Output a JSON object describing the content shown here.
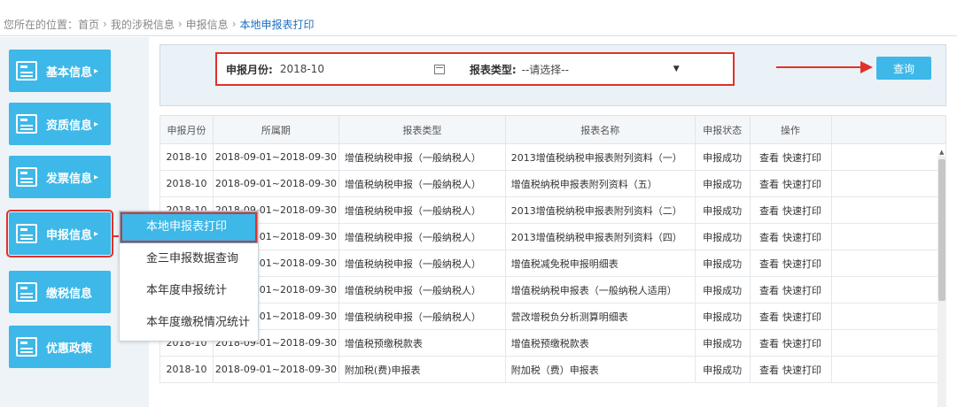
{
  "breadcrumb": {
    "prefix": "您所在的位置：",
    "items": [
      "首页",
      "我的涉税信息",
      "申报信息"
    ],
    "current": "本地申报表打印",
    "separator": "›"
  },
  "sidebar": {
    "items": [
      {
        "label": "基本信息",
        "arrow": "▸",
        "icon": "id-card-icon"
      },
      {
        "label": "资质信息",
        "arrow": "▸",
        "icon": "checklist-icon"
      },
      {
        "label": "发票信息",
        "arrow": "▸",
        "icon": "invoice-icon"
      },
      {
        "label": "申报信息",
        "arrow": "▸",
        "icon": "monitor-icon"
      },
      {
        "label": "缴税信息",
        "arrow": "",
        "icon": "tax-icon"
      },
      {
        "label": "优惠政策",
        "arrow": "",
        "icon": "policy-icon"
      }
    ],
    "active_index": 3
  },
  "flyout": {
    "items": [
      "本地申报表打印",
      "金三申报数据查询",
      "本年度申报统计",
      "本年度缴税情况统计"
    ],
    "selected_index": 0
  },
  "search": {
    "month_label": "申报月份:",
    "month_value": "2018-10",
    "type_label": "报表类型:",
    "type_value": "--请选择--",
    "query_button": "查询"
  },
  "table": {
    "headers": [
      "申报月份",
      "所属期",
      "报表类型",
      "报表名称",
      "申报状态",
      "操作"
    ],
    "rows": [
      [
        "2018-10",
        "2018-09-01~2018-09-30",
        "增值税纳税申报（一般纳税人）",
        "2013增值税纳税申报表附列资料（一）",
        "申报成功"
      ],
      [
        "2018-10",
        "2018-09-01~2018-09-30",
        "增值税纳税申报（一般纳税人）",
        "增值税纳税申报表附列资料（五）",
        "申报成功"
      ],
      [
        "2018-10",
        "2018-09-01~2018-09-30",
        "增值税纳税申报（一般纳税人）",
        "2013增值税纳税申报表附列资料（二）",
        "申报成功"
      ],
      [
        "2018-10",
        "2018-09-01~2018-09-30",
        "增值税纳税申报（一般纳税人）",
        "2013增值税纳税申报表附列资料（四）",
        "申报成功"
      ],
      [
        "2018-10",
        "2018-09-01~2018-09-30",
        "增值税纳税申报（一般纳税人）",
        "增值税减免税申报明细表",
        "申报成功"
      ],
      [
        "2018-10",
        "2018-09-01~2018-09-30",
        "增值税纳税申报（一般纳税人）",
        "增值税纳税申报表（一般纳税人适用）",
        "申报成功"
      ],
      [
        "2018-10",
        "2018-09-01~2018-09-30",
        "增值税纳税申报（一般纳税人）",
        "营改增税负分析测算明细表",
        "申报成功"
      ],
      [
        "2018-10",
        "2018-09-01~2018-09-30",
        "增值税预缴税款表",
        "增值税预缴税款表",
        "申报成功"
      ],
      [
        "2018-10",
        "2018-09-01~2018-09-30",
        "附加税(费)申报表",
        "附加税（费）申报表",
        "申报成功"
      ]
    ],
    "op_view": "查看",
    "op_print": "快速打印"
  },
  "colors": {
    "accent": "#3db8e8",
    "highlight": "#e2312a",
    "link": "#1a6fc0"
  }
}
